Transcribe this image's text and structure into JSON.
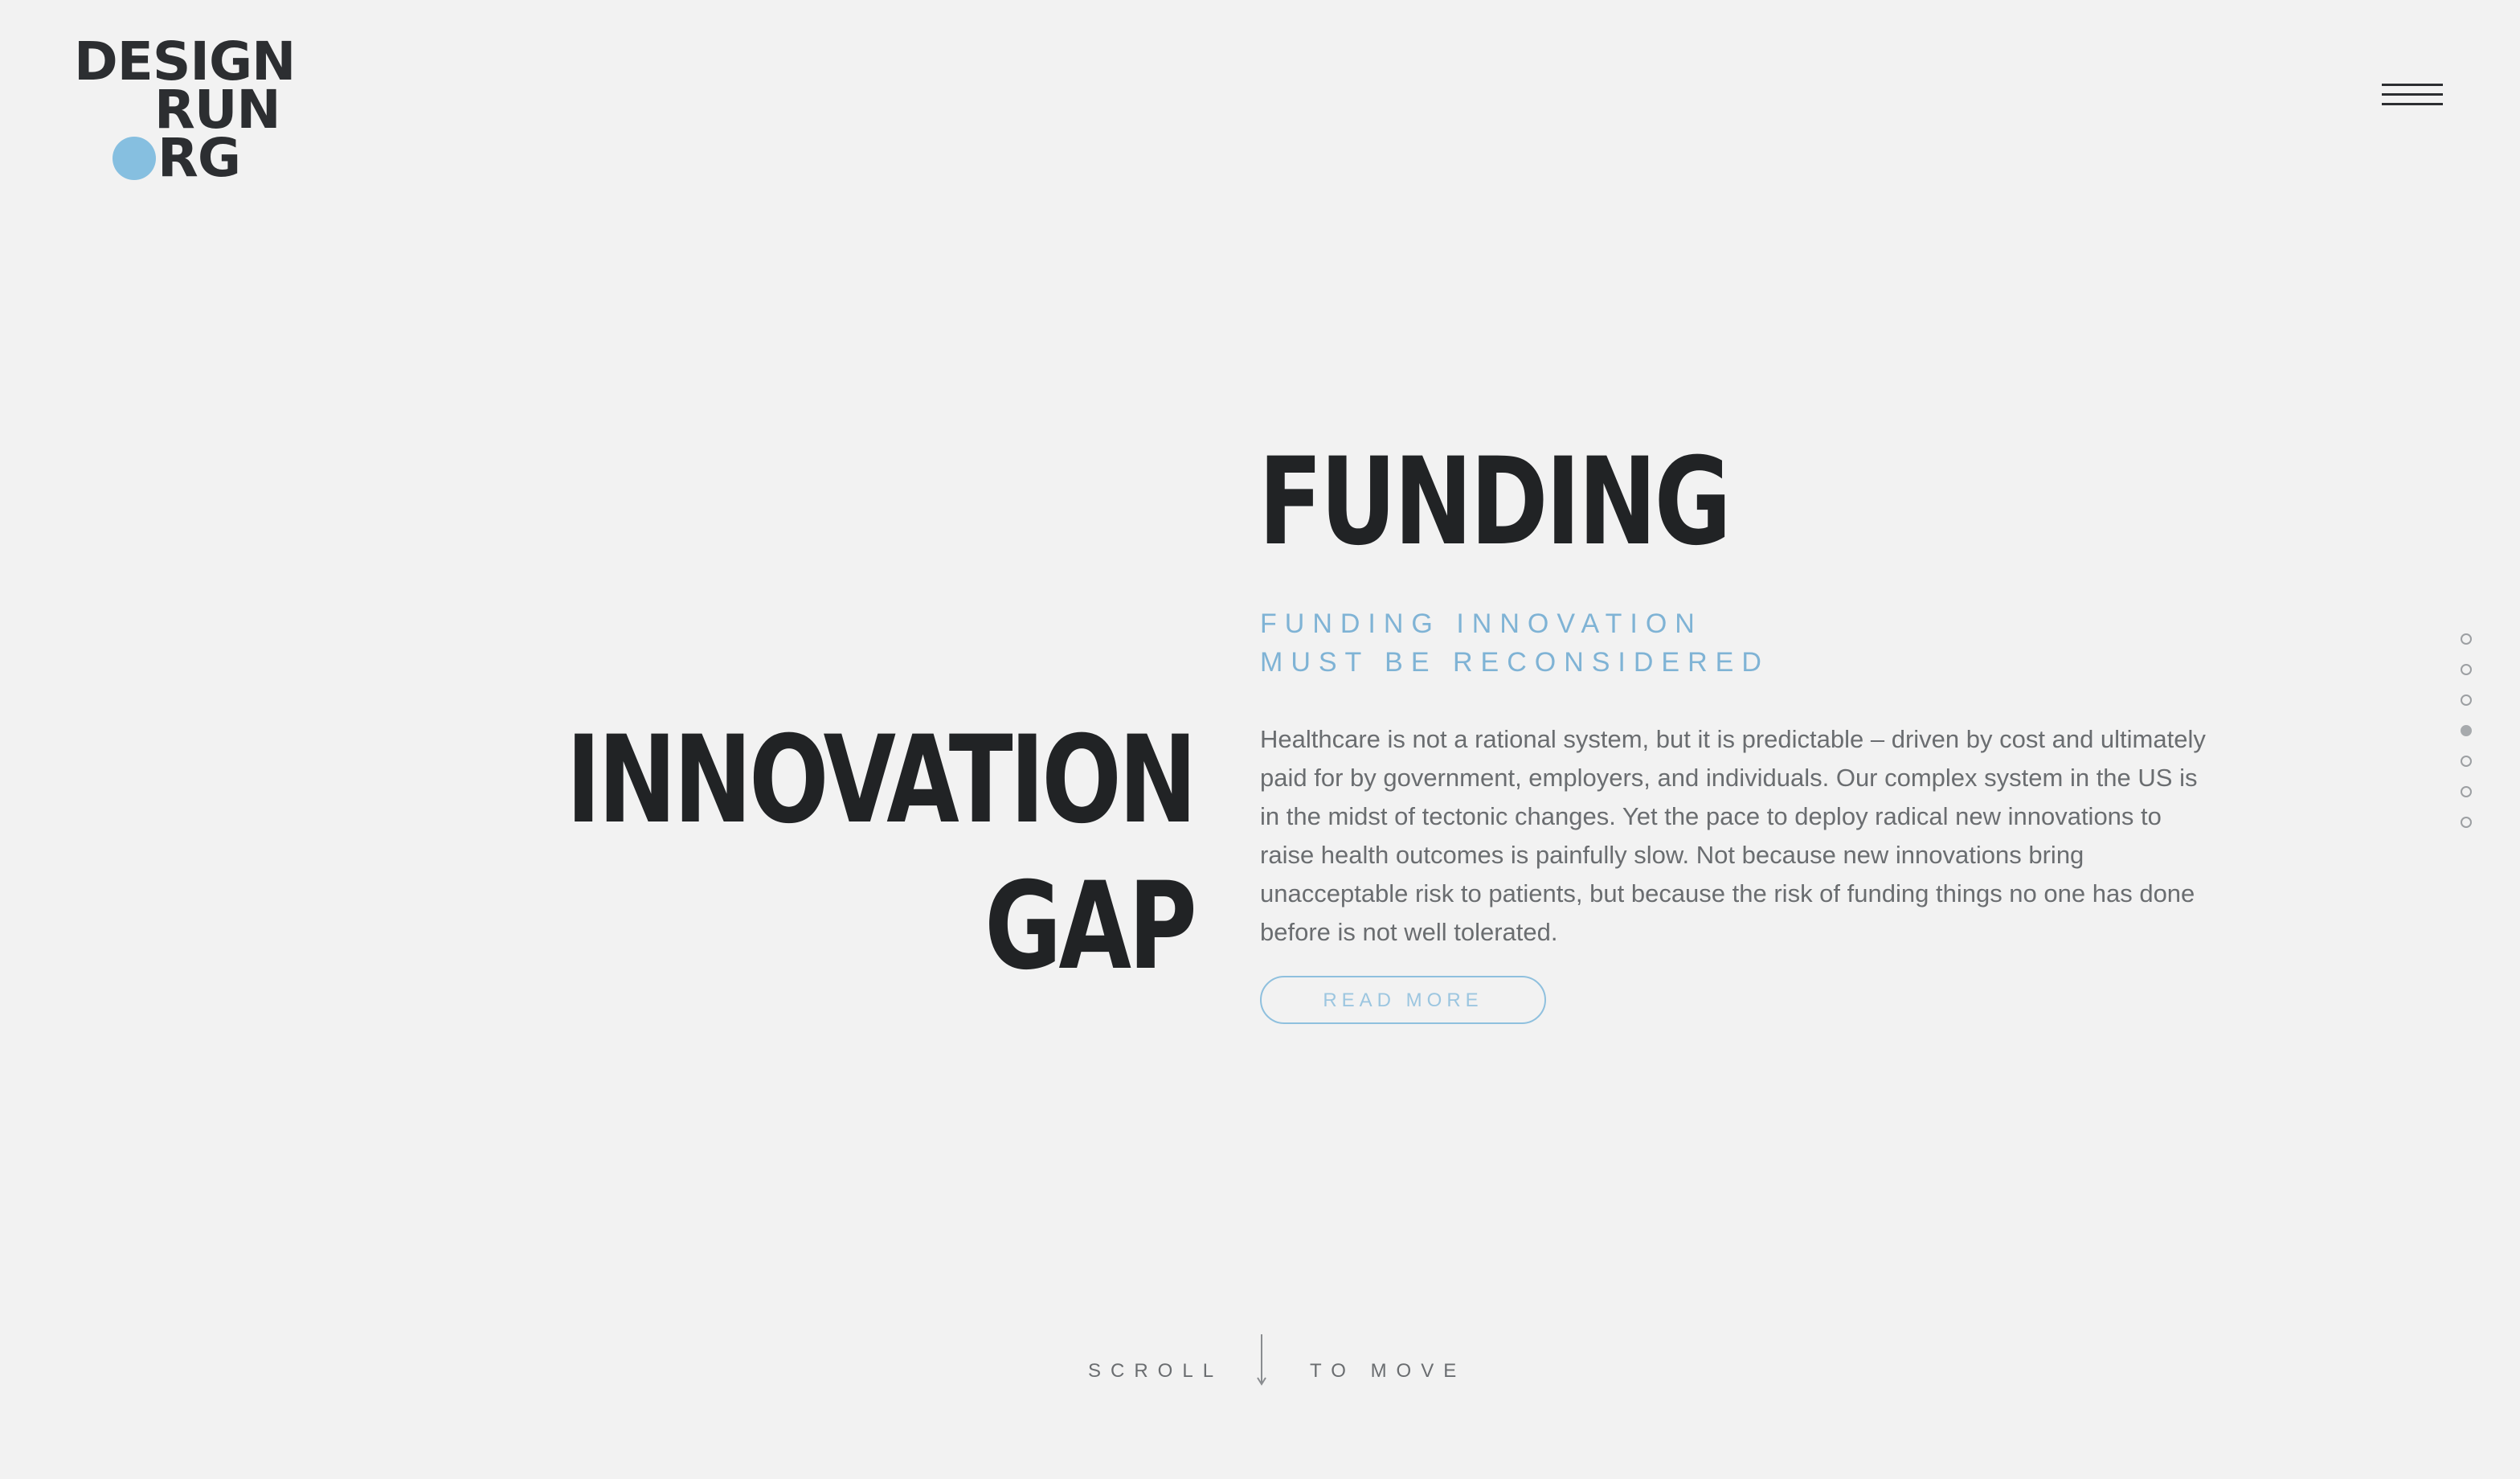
{
  "logo": {
    "line1": "DESIGN",
    "line2": "RUN",
    "line3": "RG",
    "accent_color": "#86bfe0"
  },
  "menu": {
    "icon": "hamburger-menu-icon"
  },
  "hero": {
    "left_heading_line1": "INNOVATION",
    "left_heading_line2": "GAP",
    "title": "FUNDING",
    "subtitle_line1": "FUNDING INNOVATION",
    "subtitle_line2": "MUST BE RECONSIDERED",
    "body": "Healthcare is not a rational system, but it is predictable – driven by cost and ultimately paid for by government, employers, and individuals. Our complex system in the US is in the midst of tectonic changes. Yet the pace to deploy radical new innovations to raise health outcomes is painfully slow. Not because new innovations bring unacceptable risk to patients, but because the risk of funding things no one has done before is not well tolerated.",
    "button_label": "READ MORE"
  },
  "pager": {
    "count": 7,
    "active_index": 3
  },
  "scroll_hint": {
    "left": "SCROLL",
    "right": "TO MOVE",
    "icon": "arrow-down-icon"
  },
  "colors": {
    "background": "#f2f2f2",
    "heading": "#212325",
    "accent": "#7fb3d5",
    "body_text": "#6a6d70"
  }
}
